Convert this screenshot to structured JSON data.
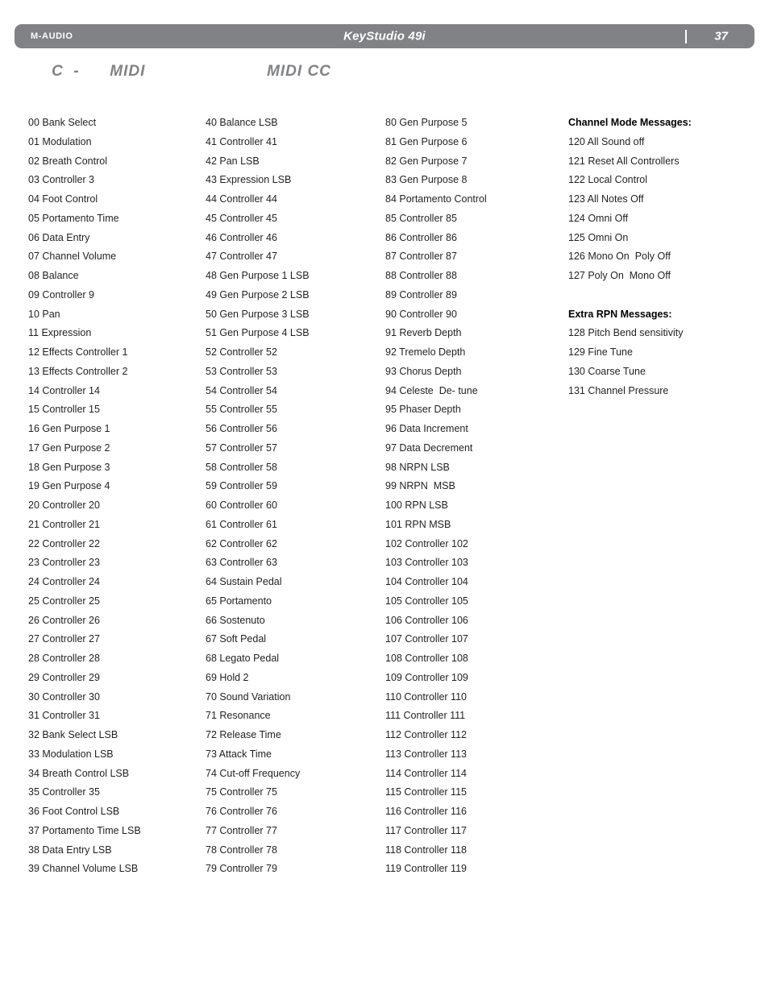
{
  "header": {
    "brand": "M-AUDIO",
    "title": "KeyStudio 49i",
    "page_number": "37",
    "bar_color": "#808285",
    "text_color": "#ffffff"
  },
  "section": {
    "title": "C  -      MIDI                        MIDI CC",
    "color": "#808285"
  },
  "columns": [
    {
      "name": "column-1",
      "entries": [
        "00 Bank Select",
        "01 Modulation",
        "02 Breath Control",
        "03 Controller 3",
        "04 Foot Control",
        "05 Portamento Time",
        "06 Data Entry",
        "07 Channel Volume",
        "08 Balance",
        "09 Controller 9",
        "10 Pan",
        "11 Expression",
        "12 Effects Controller 1",
        "13 Effects Controller 2",
        "14 Controller 14",
        "15 Controller 15",
        "16 Gen Purpose 1",
        "17 Gen Purpose 2",
        "18 Gen Purpose 3",
        "19 Gen Purpose 4",
        "20 Controller 20",
        "21 Controller 21",
        "22 Controller 22",
        "23 Controller 23",
        "24 Controller 24",
        "25 Controller 25",
        "26 Controller 26",
        "27 Controller 27",
        "28 Controller 28",
        "29 Controller 29",
        "30 Controller 30",
        "31 Controller 31",
        "32 Bank Select LSB",
        "33 Modulation LSB",
        "34 Breath Control LSB",
        "35 Controller 35",
        "36 Foot Control LSB",
        "37 Portamento Time LSB",
        "38 Data Entry LSB",
        "39 Channel Volume LSB"
      ],
      "headings": []
    },
    {
      "name": "column-2",
      "entries": [
        "40 Balance LSB",
        "41 Controller 41",
        "42 Pan LSB",
        "43 Expression LSB",
        "44 Controller 44",
        "45 Controller 45",
        "46 Controller 46",
        "47 Controller 47",
        "48 Gen Purpose 1 LSB",
        "49 Gen Purpose 2 LSB",
        "50 Gen Purpose 3 LSB",
        "51 Gen Purpose 4 LSB",
        "52 Controller 52",
        "53 Controller 53",
        "54 Controller 54",
        "55 Controller 55",
        "56 Controller 56",
        "57 Controller 57",
        "58 Controller 58",
        "59 Controller 59",
        "60 Controller 60",
        "61 Controller 61",
        "62 Controller 62",
        "63 Controller 63",
        "64 Sustain Pedal",
        "65 Portamento",
        "66 Sostenuto",
        "67 Soft Pedal",
        "68 Legato Pedal",
        "69 Hold 2",
        "70 Sound Variation",
        "71 Resonance",
        "72 Release Time",
        "73 Attack Time",
        "74 Cut-off Frequency",
        "75 Controller 75",
        "76 Controller 76",
        "77 Controller 77",
        "78 Controller 78",
        "79 Controller 79"
      ],
      "headings": []
    },
    {
      "name": "column-3",
      "entries": [
        "80 Gen Purpose 5",
        "81 Gen Purpose 6",
        "82 Gen Purpose 7",
        "83 Gen Purpose 8",
        "84 Portamento Control",
        "85 Controller 85",
        "86 Controller 86",
        "87 Controller 87",
        "88 Controller 88",
        "89 Controller 89",
        "90 Controller 90",
        "91 Reverb Depth",
        "92 Tremelo Depth",
        "93 Chorus Depth",
        "94 Celeste  De- tune",
        "95 Phaser Depth",
        "96 Data Increment",
        "97 Data Decrement",
        "98 NRPN LSB",
        "99 NRPN  MSB",
        "100 RPN LSB",
        "101 RPN MSB",
        "102 Controller 102",
        "103 Controller 103",
        "104 Controller 104",
        "105 Controller 105",
        "106 Controller 106",
        "107 Controller 107",
        "108 Controller 108",
        "109 Controller 109",
        "110 Controller 110",
        "111 Controller 111",
        "112 Controller 112",
        "113 Controller 113",
        "114 Controller 114",
        "115 Controller 115",
        "116 Controller 116",
        "117 Controller 117",
        "118 Controller 118",
        "119 Controller 119"
      ],
      "headings": []
    },
    {
      "name": "column-4",
      "entries": [
        "Channel Mode Messages:",
        "120 All Sound off",
        "121 Reset All Controllers",
        "122 Local Control",
        "123 All Notes Off",
        "124 Omni Off",
        "125 Omni On",
        "126 Mono On  Poly Off",
        "127 Poly On  Mono Off",
        "",
        "Extra RPN Messages:",
        "128 Pitch Bend sensitivity",
        "129 Fine Tune",
        "130 Coarse Tune",
        "131 Channel Pressure"
      ],
      "headings": [
        0,
        10
      ]
    }
  ]
}
